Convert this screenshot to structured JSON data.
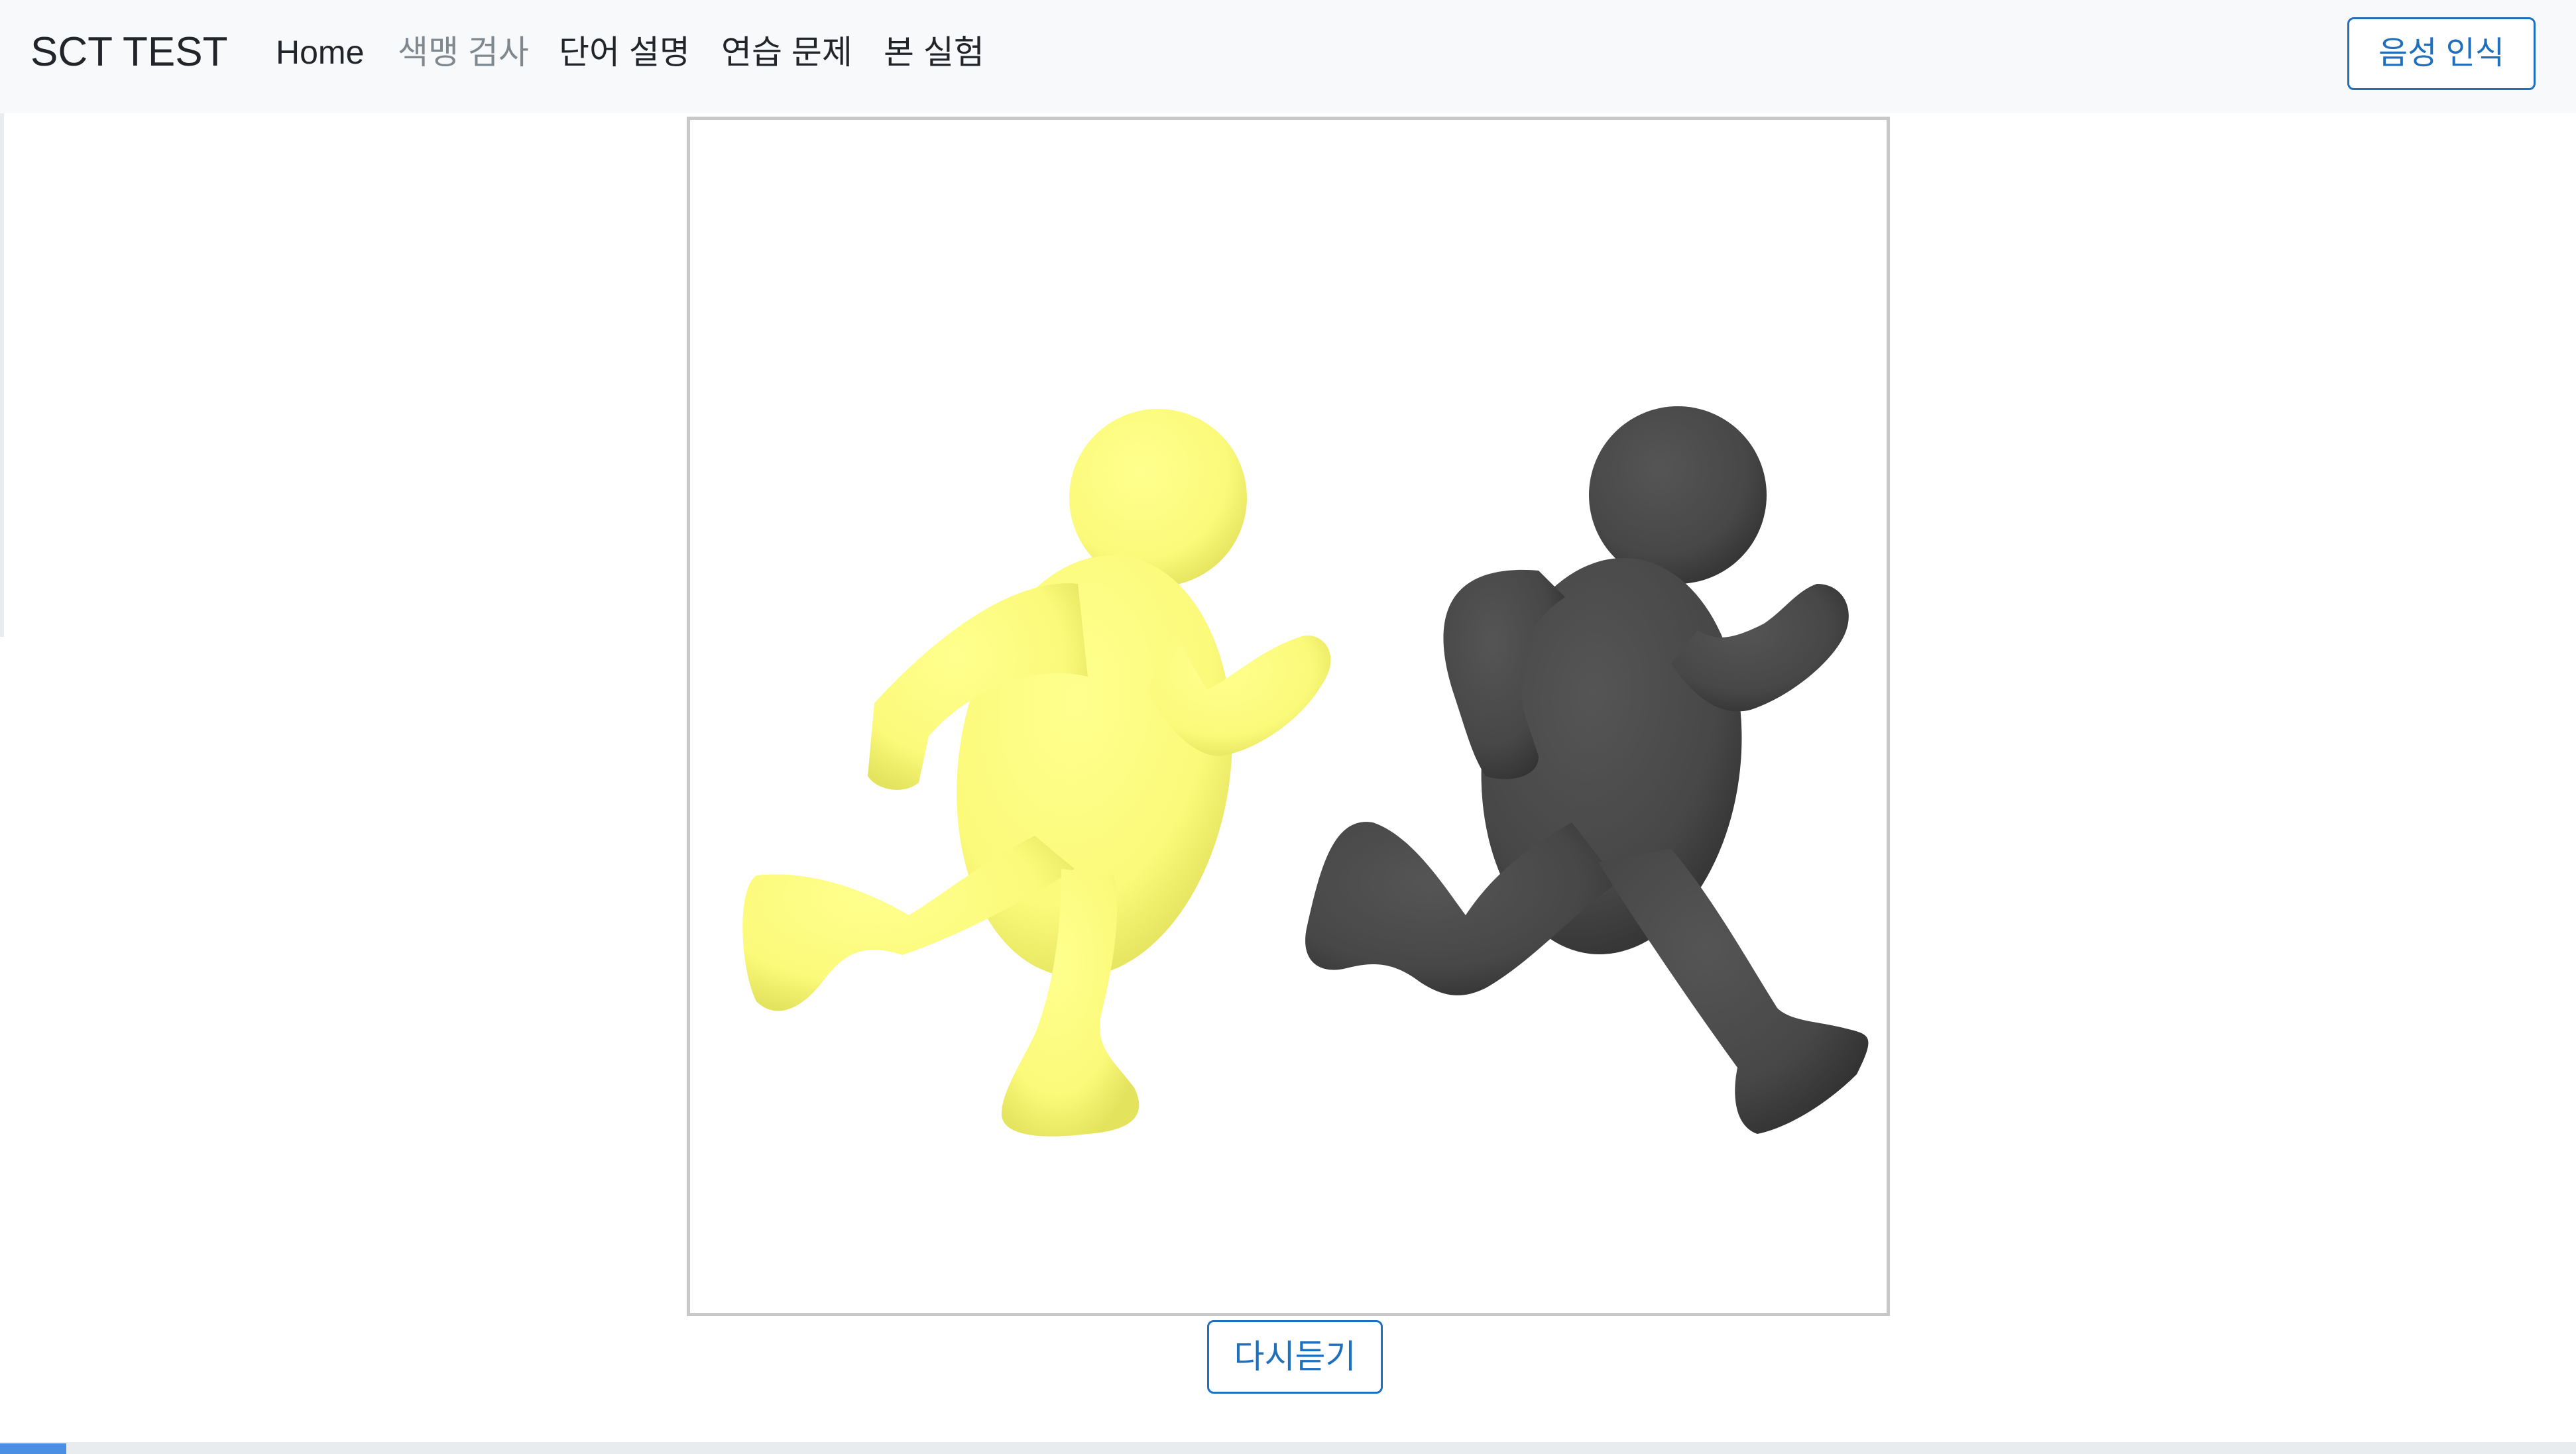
{
  "navbar": {
    "brand": "SCT TEST",
    "links": [
      {
        "label": "Home",
        "active": false
      },
      {
        "label": "색맹 검사",
        "active": true
      },
      {
        "label": "단어 설명",
        "active": false
      },
      {
        "label": "연습 문제",
        "active": false
      },
      {
        "label": "본 실험",
        "active": false
      }
    ],
    "voice_button": "음성 인식"
  },
  "stimulus": {
    "figures": [
      {
        "name": "runner-yellow",
        "color": "#fbfa7a"
      },
      {
        "name": "runner-dark",
        "color": "#474747"
      }
    ]
  },
  "replay_button": "다시듣기",
  "colors": {
    "accent": "#1f6fbf",
    "navbar_bg": "#f8f9fa",
    "yellow_figure": "#fbfa7a",
    "dark_figure": "#474747"
  }
}
